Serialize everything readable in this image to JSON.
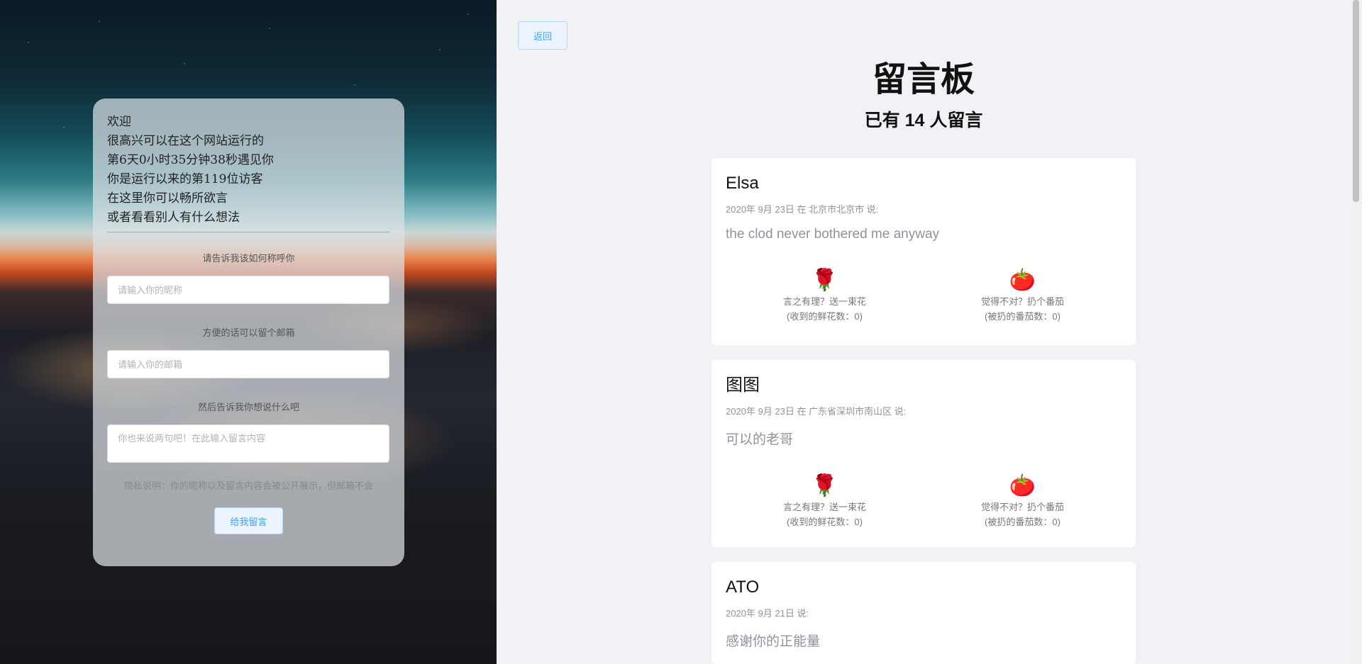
{
  "welcome_lines": [
    "欢迎",
    "很高兴可以在这个网站运行的",
    "第6天0小时35分钟38秒遇见你",
    "你是运行以来的第119位访客",
    "在这里你可以畅所欲言",
    "或者看看别人有什么想法"
  ],
  "form": {
    "name_label": "请告诉我该如何称呼你",
    "name_placeholder": "请输入你的昵称",
    "email_label": "方便的话可以留个邮箱",
    "email_placeholder": "请输入你的邮箱",
    "message_label": "然后告诉我你想说什么吧",
    "message_placeholder": "你也来说两句吧！在此输入留言内容",
    "privacy": "隐私说明：你的昵称以及留言内容会被公开展示，但邮箱不会",
    "submit_label": "给我留言"
  },
  "back_label": "返回",
  "title": "留言板",
  "subtitle": "已有 14 人留言",
  "messages": [
    {
      "name": "Elsa",
      "meta": "2020年 9月 23日 在 北京市北京市 说:",
      "content": "the clod never bothered me anyway",
      "flower_label": "言之有理？送一束花",
      "flower_count": "(收到的鲜花数：0)",
      "tomato_label": "觉得不对？扔个番茄",
      "tomato_count": "(被扔的番茄数：0)"
    },
    {
      "name": "图图",
      "meta": "2020年 9月 23日 在 广东省深圳市南山区 说:",
      "content": "可以的老哥",
      "flower_label": "言之有理？送一束花",
      "flower_count": "(收到的鲜花数：0)",
      "tomato_label": "觉得不对？扔个番茄",
      "tomato_count": "(被扔的番茄数：0)"
    },
    {
      "name": "ATO",
      "meta": "2020年 9月 21日 说:",
      "content": "感谢你的正能量"
    }
  ],
  "icons": {
    "flower": "🌹",
    "tomato": "🍅"
  },
  "colors": {
    "primary": "#409eff",
    "primary_light_bg": "#ecf5ff",
    "page_bg": "#f0f2f5"
  }
}
